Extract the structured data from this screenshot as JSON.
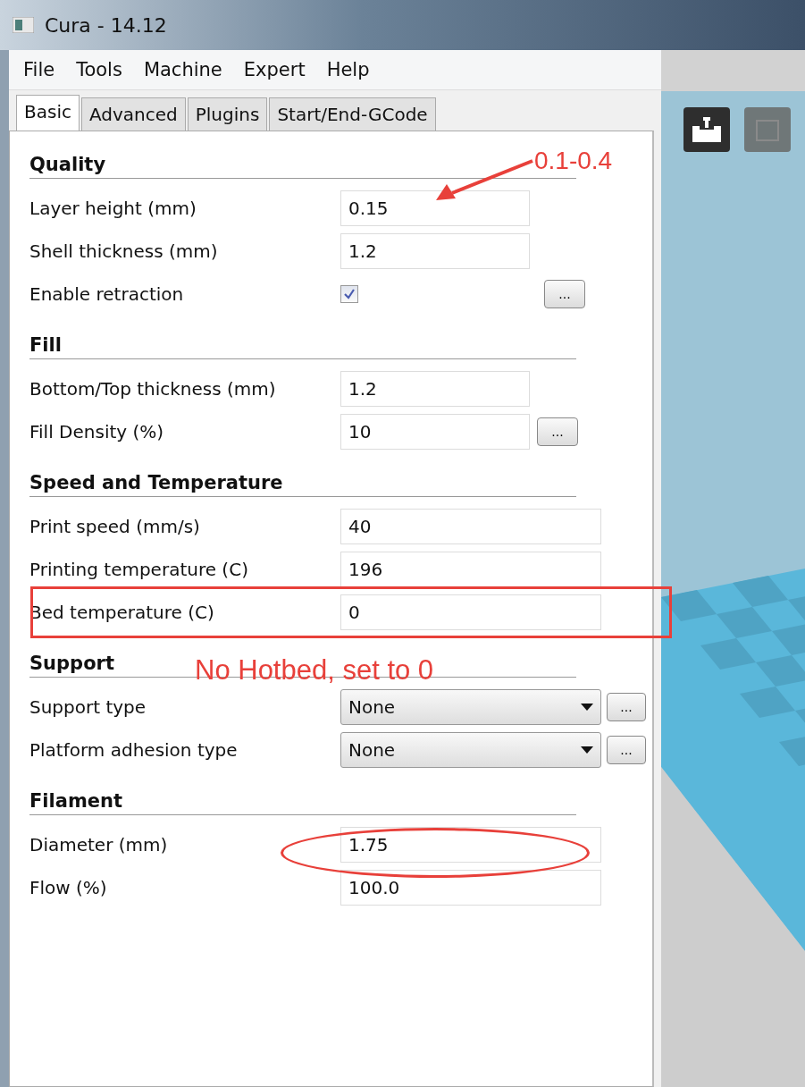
{
  "window": {
    "title": "Cura - 14.12"
  },
  "menu": [
    "File",
    "Tools",
    "Machine",
    "Expert",
    "Help"
  ],
  "tabs": [
    {
      "label": "Basic",
      "selected": true
    },
    {
      "label": "Advanced",
      "selected": false
    },
    {
      "label": "Plugins",
      "selected": false
    },
    {
      "label": "Start/End-GCode",
      "selected": false
    }
  ],
  "sections": [
    {
      "title": "Quality",
      "rows": [
        {
          "kind": "text",
          "label": "Layer height (mm)",
          "value": "0.15"
        },
        {
          "kind": "text",
          "label": "Shell thickness (mm)",
          "value": "1.2"
        },
        {
          "kind": "checkbox",
          "label": "Enable retraction",
          "checked": true,
          "more": "..."
        }
      ]
    },
    {
      "title": "Fill",
      "rows": [
        {
          "kind": "text",
          "label": "Bottom/Top thickness (mm)",
          "value": "1.2"
        },
        {
          "kind": "text",
          "label": "Fill Density (%)",
          "value": "10",
          "more": "..."
        }
      ]
    },
    {
      "title": "Speed and Temperature",
      "rows": [
        {
          "kind": "text",
          "label": "Print speed (mm/s)",
          "value": "40"
        },
        {
          "kind": "text",
          "label": "Printing temperature (C)",
          "value": "196"
        },
        {
          "kind": "text",
          "label": "Bed temperature (C)",
          "value": "0"
        }
      ]
    },
    {
      "title": "Support",
      "rows": [
        {
          "kind": "select",
          "label": "Support type",
          "value": "None",
          "more": "..."
        },
        {
          "kind": "select",
          "label": "Platform adhesion type",
          "value": "None",
          "more": "..."
        }
      ]
    },
    {
      "title": "Filament",
      "rows": [
        {
          "kind": "text",
          "label": "Diameter (mm)",
          "value": "1.75"
        },
        {
          "kind": "text",
          "label": "Flow (%)",
          "value": "100.0"
        }
      ]
    }
  ],
  "annotations": [
    {
      "kind": "arrow",
      "text": "0.1-0.4"
    },
    {
      "kind": "box"
    },
    {
      "kind": "note",
      "text": "No Hotbed, set to 0"
    },
    {
      "kind": "ellipse"
    }
  ]
}
